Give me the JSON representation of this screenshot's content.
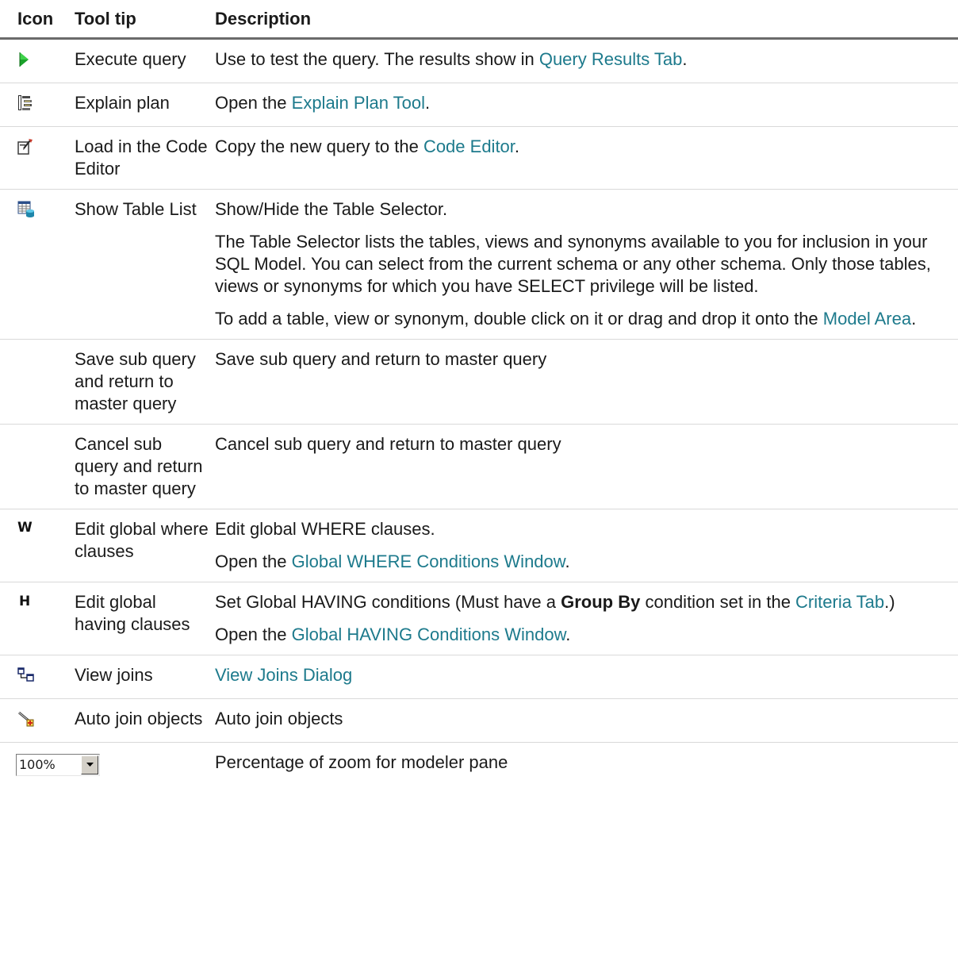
{
  "header": {
    "icon": "Icon",
    "tooltip": "Tool tip",
    "description": "Description"
  },
  "rows": [
    {
      "icon": "execute-query-icon",
      "tooltip": "Execute query",
      "desc": {
        "p0_a": "Use to test the query. The results show in ",
        "p0_link": "Query Results Tab",
        "p0_b": "."
      }
    },
    {
      "icon": "explain-plan-icon",
      "tooltip": "Explain plan",
      "desc": {
        "p0_a": "Open the ",
        "p0_link": "Explain Plan Tool",
        "p0_b": "."
      }
    },
    {
      "icon": "load-in-code-editor-icon",
      "tooltip": "Load in the Code Editor",
      "desc": {
        "p0_a": "Copy the new query to the ",
        "p0_link": "Code Editor",
        "p0_b": "."
      }
    },
    {
      "icon": "show-table-list-icon",
      "tooltip": "Show Table List",
      "desc": {
        "p0": "Show/Hide the Table Selector.",
        "p1": "The Table Selector lists the tables, views and synonyms available to you for inclusion in your SQL Model. You can select from the current schema or any other schema. Only those tables, views or synonyms for which you have SELECT privilege will be listed.",
        "p2_a": "To add a table, view or synonym, double click on it or drag and drop it onto the ",
        "p2_link": "Model Area",
        "p2_b": "."
      }
    },
    {
      "icon": "",
      "tooltip": "Save sub query and return to master query",
      "desc": {
        "p0": "Save sub query and return to master query"
      }
    },
    {
      "icon": "",
      "tooltip": "Cancel sub query and return to master query",
      "desc": {
        "p0": "Cancel sub query and return to master query"
      }
    },
    {
      "icon": "edit-global-where-icon",
      "tooltip": "Edit global where clauses",
      "desc": {
        "p0": "Edit global WHERE clauses.",
        "p1_a": "Open the ",
        "p1_link": "Global WHERE Conditions Window",
        "p1_b": "."
      }
    },
    {
      "icon": "edit-global-having-icon",
      "tooltip": "Edit global having clauses",
      "desc": {
        "p0_a": "Set Global HAVING conditions (Must have a ",
        "p0_bold": "Group By",
        "p0_b": " condition set in the ",
        "p0_link": "Criteria Tab",
        "p0_c": ".)",
        "p1_a": "Open the ",
        "p1_link": "Global HAVING Conditions Window",
        "p1_b": "."
      }
    },
    {
      "icon": "view-joins-icon",
      "tooltip": "View joins",
      "desc": {
        "p0_link": "View Joins Dialog"
      }
    },
    {
      "icon": "auto-join-objects-icon",
      "tooltip": "Auto join objects",
      "desc": {
        "p0": "Auto join objects"
      }
    },
    {
      "icon": "zoom-combobox",
      "zoom_value": "100%",
      "tooltip": "",
      "desc": {
        "p0": "Percentage of zoom for modeler pane"
      }
    }
  ],
  "colors": {
    "link": "#1d7a8c",
    "header_rule": "#6b6b6b",
    "row_rule": "#d9d9d9",
    "execute_green": "#1aa12a"
  }
}
